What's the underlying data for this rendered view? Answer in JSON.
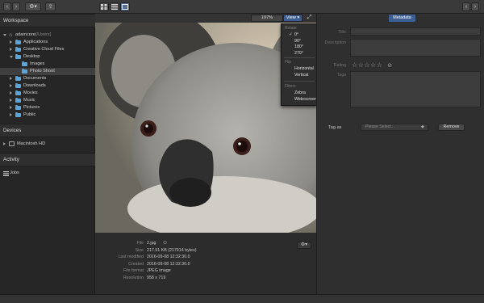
{
  "toolbar": {
    "back_label": "‹",
    "forward_label": "›",
    "gear_label": "⚙▾",
    "export_label": "⇪",
    "right_back_label": "‹",
    "right_forward_label": "›"
  },
  "sidebar": {
    "workspace_title": "Workspace",
    "tree": [
      {
        "label": "adamcore",
        "suffix": " [/Users]",
        "level": 0,
        "expanded": true,
        "icon": "home-icon"
      },
      {
        "label": "Applications",
        "level": 1,
        "expanded": false,
        "icon": "folder-icon"
      },
      {
        "label": "Creative Cloud Files",
        "level": 1,
        "expanded": false,
        "icon": "folder-icon"
      },
      {
        "label": "Desktop",
        "level": 1,
        "expanded": true,
        "icon": "folder-icon"
      },
      {
        "label": "Images",
        "level": 2,
        "expanded": null,
        "icon": "folder-icon"
      },
      {
        "label": "Photo Shoot",
        "level": 2,
        "expanded": null,
        "icon": "folder-icon",
        "selected": true
      },
      {
        "label": "Documents",
        "level": 1,
        "expanded": false,
        "icon": "folder-icon"
      },
      {
        "label": "Downloads",
        "level": 1,
        "expanded": false,
        "icon": "folder-icon"
      },
      {
        "label": "Movies",
        "level": 1,
        "expanded": false,
        "icon": "folder-icon"
      },
      {
        "label": "Music",
        "level": 1,
        "expanded": false,
        "icon": "folder-icon"
      },
      {
        "label": "Pictures",
        "level": 1,
        "expanded": false,
        "icon": "folder-icon"
      },
      {
        "label": "Public",
        "level": 1,
        "expanded": false,
        "icon": "folder-icon"
      }
    ],
    "devices_title": "Devices",
    "device_label": "Macintosh HD",
    "activity_title": "Activity",
    "jobs_label": "Jobs"
  },
  "viewer": {
    "zoom": "197%",
    "view_label": "View ▾",
    "fullscreen_label": "⤢"
  },
  "view_menu": {
    "rotate_header": "Rotate",
    "rotate_items": [
      "0°",
      "90°",
      "180°",
      "270°"
    ],
    "rotate_checked": "0°",
    "flip_header": "Flip",
    "flip_items": [
      "Horizontal",
      "Vertical"
    ],
    "filters_header": "Filters",
    "filter_items": [
      "Zebra",
      "Widescreen"
    ]
  },
  "file_info": {
    "rows": [
      {
        "key": "File",
        "value": "2.jpg"
      },
      {
        "key": "Size",
        "value": "217.91 KB (217914 bytes)"
      },
      {
        "key": "Last modified",
        "value": "2016-09-08 12:32:30.0"
      },
      {
        "key": "Created",
        "value": "2016-09-08 12:32:30.0"
      },
      {
        "key": "File format",
        "value": "JPEG image"
      },
      {
        "key": "Resolution",
        "value": "958 x 719"
      }
    ],
    "gear_label": "⚙▾"
  },
  "metadata": {
    "tab_label": "Metadata",
    "title_label": "Title",
    "description_label": "Description",
    "rating_label": "Rating",
    "rating_value": 0,
    "rating_max": 5,
    "tags_label": "Tags",
    "tag_as_label": "Tag as",
    "tag_select_placeholder": "Please Select...",
    "remove_label": "Remove"
  }
}
